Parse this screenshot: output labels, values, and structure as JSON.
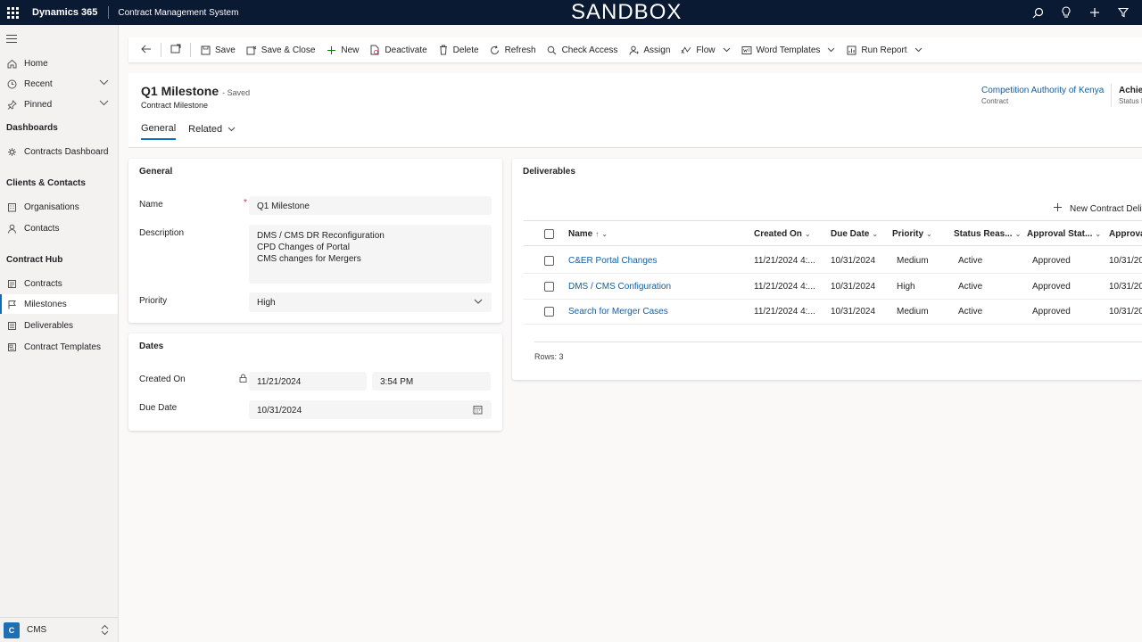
{
  "topbar": {
    "brand": "Dynamics 365",
    "app_name": "Contract Management System",
    "environment": "SANDBOX",
    "icons": [
      "search-icon",
      "lightbulb-icon",
      "plus-icon",
      "filter-icon"
    ]
  },
  "sidebar": {
    "top_items": [
      {
        "label": "Home",
        "icon": "home-icon"
      },
      {
        "label": "Recent",
        "icon": "clock-icon"
      },
      {
        "label": "Pinned",
        "icon": "pin-icon"
      }
    ],
    "groups": [
      {
        "heading": "Dashboards",
        "items": [
          {
            "label": "Contracts Dashboard",
            "icon": "dashboard-icon"
          }
        ]
      },
      {
        "heading": "Clients & Contacts",
        "items": [
          {
            "label": "Organisations",
            "icon": "building-icon"
          },
          {
            "label": "Contacts",
            "icon": "person-icon"
          }
        ]
      },
      {
        "heading": "Contract Hub",
        "items": [
          {
            "label": "Contracts",
            "icon": "document-icon"
          },
          {
            "label": "Milestones",
            "icon": "flag-icon"
          },
          {
            "label": "Deliverables",
            "icon": "list-icon"
          },
          {
            "label": "Contract Templates",
            "icon": "template-icon"
          }
        ]
      }
    ],
    "active": "Milestones",
    "area": {
      "badge": "C",
      "label": "CMS"
    }
  },
  "commandbar": {
    "save": "Save",
    "save_close": "Save & Close",
    "new": "New",
    "deactivate": "Deactivate",
    "delete": "Delete",
    "refresh": "Refresh",
    "check_access": "Check Access",
    "assign": "Assign",
    "flow": "Flow",
    "word_templates": "Word Templates",
    "run_report": "Run Report"
  },
  "header": {
    "title": "Q1 Milestone",
    "saved_status": "- Saved",
    "entity": "Contract Milestone",
    "tabs": [
      "General",
      "Related"
    ],
    "contract_value": "Competition Authority of Kenya",
    "contract_label": "Contract",
    "status_value": "Achiev",
    "status_label": "Status R"
  },
  "general_section": {
    "title": "General",
    "name_label": "Name",
    "name_value": "Q1 Milestone",
    "description_label": "Description",
    "description_lines": [
      "DMS / CMS DR Reconfiguration",
      "CPD Changes of Portal",
      "CMS changes for Mergers"
    ],
    "priority_label": "Priority",
    "priority_value": "High"
  },
  "dates_section": {
    "title": "Dates",
    "created_on_label": "Created On",
    "created_on_date": "11/21/2024",
    "created_on_time": "3:54 PM",
    "due_date_label": "Due Date",
    "due_date_value": "10/31/2024"
  },
  "deliverables": {
    "title": "Deliverables",
    "new_button": "New Contract Deliv",
    "columns": [
      "Name",
      "Created On",
      "Due Date",
      "Priority",
      "Status Reas...",
      "Approval Stat...",
      "Approva"
    ],
    "rows": [
      {
        "name": "C&ER Portal Changes",
        "created_on": "11/21/2024 4:...",
        "due_date": "10/31/2024",
        "priority": "Medium",
        "status": "Active",
        "approval": "Approved",
        "approval_date": "10/31/20"
      },
      {
        "name": "DMS / CMS Configuration",
        "created_on": "11/21/2024 4:...",
        "due_date": "10/31/2024",
        "priority": "High",
        "status": "Active",
        "approval": "Approved",
        "approval_date": "10/31/20"
      },
      {
        "name": "Search for Merger Cases",
        "created_on": "11/21/2024 4:...",
        "due_date": "10/31/2024",
        "priority": "Medium",
        "status": "Active",
        "approval": "Approved",
        "approval_date": "10/31/20"
      }
    ],
    "rows_count": "Rows: 3"
  }
}
